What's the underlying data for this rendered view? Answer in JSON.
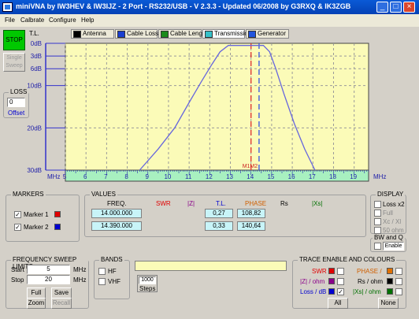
{
  "window": {
    "title": "miniVNA by IW3HEV & IW3IJZ - 2 Port - RS232/USB - V 2.3.3 - Updated 06/2008 by G3RXQ & IK3ZGB"
  },
  "menu": [
    "File",
    "Calbrate",
    "Configure",
    "Help"
  ],
  "left": {
    "stop_label": "STOP",
    "single_sweep_label": "Single\nSweep",
    "tl_label": "T.L.",
    "loss_legend": "LOSS",
    "loss_value": "0",
    "offset_label": "Offset"
  },
  "tabs": [
    {
      "label": "Antenna",
      "color": "#000000"
    },
    {
      "label": "Cable Loss",
      "color": "#1a3fd0"
    },
    {
      "label": "Cable Length",
      "color": "#1a8a1a"
    },
    {
      "label": "Transmission",
      "color": "#36c0c8"
    },
    {
      "label": "Generator",
      "color": "#2255dd"
    }
  ],
  "chart": {
    "y_ticks": [
      "0dB",
      "3dB",
      "6dB",
      "10dB",
      "20dB",
      "30dB"
    ],
    "x_ticks": [
      "5",
      "6",
      "7",
      "8",
      "9",
      "10",
      "11",
      "12",
      "13",
      "14",
      "15",
      "16",
      "17",
      "18",
      "19"
    ],
    "x_unit": "MHz",
    "marker_tag": "M1M2",
    "bg_color": "#fbfbb8",
    "trace_color": "#6666dd",
    "marker1_color": "#e03030",
    "marker2_color": "#3050e0"
  },
  "chart_data": {
    "type": "line",
    "xlim": [
      5,
      19.7
    ],
    "ylim": [
      0,
      30
    ],
    "y_scale": "dB, inverted (0 dB at top)",
    "series": [
      {
        "x": [
          8.6,
          9.5,
          10.3,
          11.0,
          11.6,
          12.1,
          12.5,
          12.9,
          14.6,
          14.9,
          15.2,
          15.6,
          16.1,
          16.6,
          17.1
        ],
        "y": [
          30,
          25,
          20,
          14,
          9,
          5,
          2,
          0.5,
          0.5,
          2,
          6,
          12,
          19,
          25,
          30
        ]
      }
    ],
    "markers": [
      {
        "x": 14.0
      },
      {
        "x": 14.39
      }
    ]
  },
  "markers_panel": {
    "legend": "MARKERS",
    "items": [
      {
        "label": "Marker 1",
        "color": "#e00000"
      },
      {
        "label": "Marker 2",
        "color": "#0000d0"
      }
    ]
  },
  "values_panel": {
    "legend": "VALUES",
    "headers": {
      "freq": "FREQ.",
      "swr": "SWR",
      "z": "|Z|",
      "tl": "T.L.",
      "phase": "PHASE",
      "rs": "Rs",
      "xs": "|Xs|"
    },
    "rows": [
      {
        "freq": "14.000.000",
        "tl": "0,27",
        "phase": "108,82"
      },
      {
        "freq": "14.390.000",
        "tl": "0,33",
        "phase": "140,64"
      }
    ]
  },
  "display_panel": {
    "legend": "DISPLAY",
    "items": [
      "Loss x2",
      "Full",
      "Xc / Xl",
      "50 ohm"
    ]
  },
  "bwq_panel": {
    "legend": "BW and Q",
    "enable_label": "Enable"
  },
  "sweep": {
    "legend": "FREQUENCY SWEEP LIMITS",
    "start_label": "Start",
    "start_value": "5",
    "stop_label": "Stop",
    "stop_value": "20",
    "unit": "MHz",
    "full": "Full",
    "save": "Save",
    "zoom": "Zoom",
    "recall": "Recall"
  },
  "bands": {
    "legend": "BANDS",
    "hf": "HF",
    "vhf": "VHF"
  },
  "steps": {
    "value": "1000",
    "label": "Steps"
  },
  "trace": {
    "legend": "TRACE ENABLE AND COLOURS",
    "left": [
      {
        "label": "SWR",
        "color": "#e00000"
      },
      {
        "label": "|Z| / ohm",
        "color": "#8a008a"
      },
      {
        "label": "Loss / dB",
        "color": "#0000d0"
      }
    ],
    "right": [
      {
        "label": "PHASE /",
        "color": "#e07000"
      },
      {
        "label": "Rs / ohm",
        "color": "#000000"
      },
      {
        "label": "|Xs| / ohm",
        "color": "#007000"
      }
    ],
    "all": "All",
    "none": "None"
  }
}
